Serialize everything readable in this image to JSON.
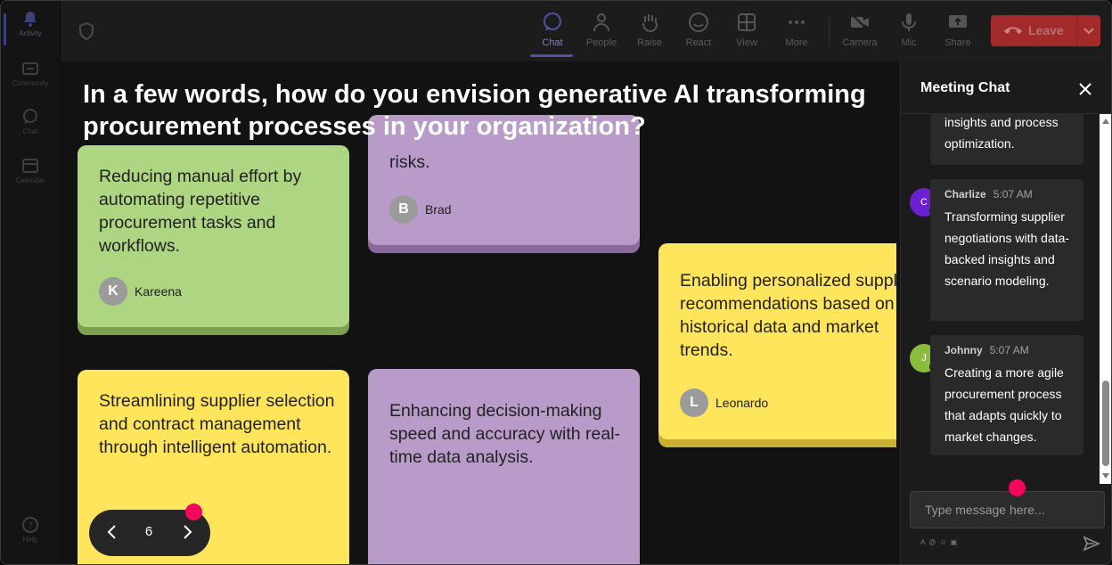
{
  "rail": {
    "items": [
      {
        "label": "Activity",
        "icon": "bell-icon"
      },
      {
        "label": "Community",
        "icon": "community-icon"
      },
      {
        "label": "Chat",
        "icon": "chat-icon"
      },
      {
        "label": "Calendar",
        "icon": "calendar-icon"
      }
    ],
    "help": "Help"
  },
  "toolbar": {
    "chat": "Chat",
    "people": "People",
    "raise": "Raise",
    "react": "React",
    "view": "View",
    "more": "More",
    "camera": "Camera",
    "mic": "Mic",
    "share": "Share",
    "leave": "Leave"
  },
  "stage": {
    "question": "In a few words, how do you envision generative AI transforming procurement processes in your organization?",
    "notes": [
      {
        "text": "Reducing manual effort by automating repetitive procurement tasks and workflows.",
        "author": "Kareena",
        "initial": "K",
        "color": "green"
      },
      {
        "text": "risks.",
        "author": "Brad",
        "initial": "B",
        "color": "purple"
      },
      {
        "text": "Enabling personalized supplier recommendations based on historical data and market trends.",
        "author": "Leonardo",
        "initial": "L",
        "color": "yellow"
      },
      {
        "text": "Streamlining supplier selection and contract management through intelligent automation.",
        "color": "yellow"
      },
      {
        "text": "Enhancing decision-making speed and accuracy with real-time data analysis.",
        "color": "purple"
      }
    ],
    "page": "6"
  },
  "chat": {
    "title": "Meeting Chat",
    "messages": [
      {
        "body": "insights and process optimization."
      },
      {
        "name": "Charlize",
        "time": "5:07 AM",
        "initial": "C",
        "avatar_color": "#6a1fd0",
        "body": "Transforming supplier negotiations with data-backed insights and scenario modeling."
      },
      {
        "name": "Johnny",
        "time": "5:07 AM",
        "initial": "J",
        "avatar_color": "#8bbd3c",
        "body": "Creating a more agile procurement process that adapts quickly to market changes."
      }
    ],
    "placeholder": "Type message here..."
  },
  "colors": {
    "accent": "#4c52a4",
    "leave": "#a32a2a",
    "marker": "#f2065e"
  }
}
